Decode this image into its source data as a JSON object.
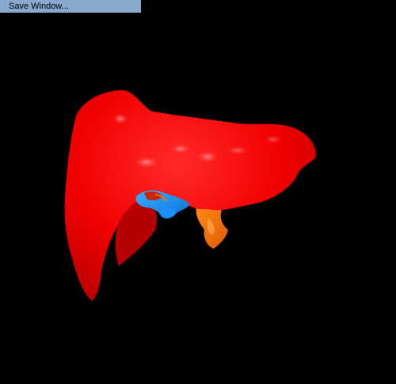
{
  "menu": {
    "save_window_label": "Save Window..."
  },
  "colors": {
    "background": "#000000",
    "menu_highlight": "#87a9cd",
    "liver": "#ff0000",
    "portal_vein": "#1e90ff",
    "hepatic_artery": "#ff7a00",
    "vena_cava": "#c82400"
  }
}
